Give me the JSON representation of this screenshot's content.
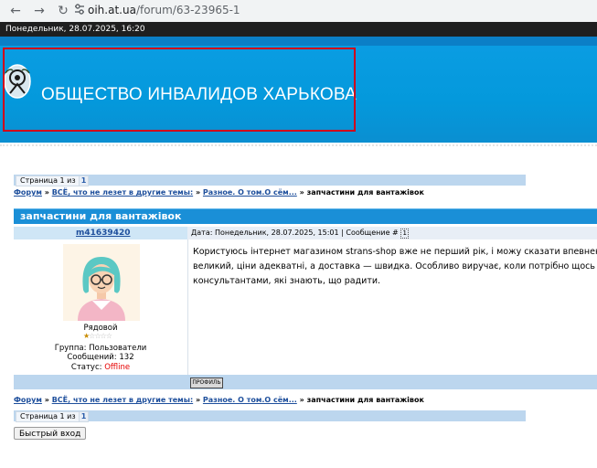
{
  "browser": {
    "url_domain": "oih.at.ua",
    "url_path": "/forum/63-23965-1",
    "back_icon": "arrow-left-icon",
    "forward_icon": "arrow-right-icon",
    "reload_icon": "reload-icon",
    "site_info_icon": "tune-icon"
  },
  "datebar": {
    "text": "Понедельник, 28.07.2025, 16:20"
  },
  "header": {
    "site_title": "ОБЩЕСТВО ИНВАЛИДОВ ХАРЬКОВА"
  },
  "pagination_top": {
    "label": "Страница 1 из 1",
    "pages": [
      "1"
    ]
  },
  "pagination_bottom": {
    "label": "Страница 1 из 1",
    "pages": [
      "1"
    ]
  },
  "breadcrumb": {
    "forum": "Форум",
    "sep": "»",
    "section": "ВСЁ, что не лезет в другие темы:",
    "subsection": "Разное. О том.О сём...",
    "current": "запчастини для вантажівок"
  },
  "topic": {
    "title": "запчастини для вантажівок"
  },
  "post": {
    "username": "m41639420",
    "meta": "Дата: Понедельник, 28.07.2025, 15:01 | Сообщение #",
    "message_number": "1",
    "text_lines": [
      "Користуюсь інтернет магазином strans-shop вже не перший рік, і можу сказати впевнено — ту",
      "великий, ціни адекватні, а доставка — швидка. Особливо виручає, коли потрібно щось термін",
      "консультантами, які знають, що радити."
    ],
    "rank": "Рядовой",
    "rank_stars": {
      "filled": 1,
      "total": 5
    },
    "group_label": "Группа:",
    "group_value": "Пользователи",
    "messages_label": "Сообщений:",
    "messages_value": "132",
    "status_label": "Статус:",
    "status_value": "Offline",
    "profile_button": "ПРОФИЛЬ"
  },
  "quick_login": {
    "label": "Быстрый вход"
  },
  "colors": {
    "banner": "#0b9de3",
    "topic_bar": "#1a8fd7",
    "offline": "#e60000",
    "link": "#1e4f9c"
  }
}
